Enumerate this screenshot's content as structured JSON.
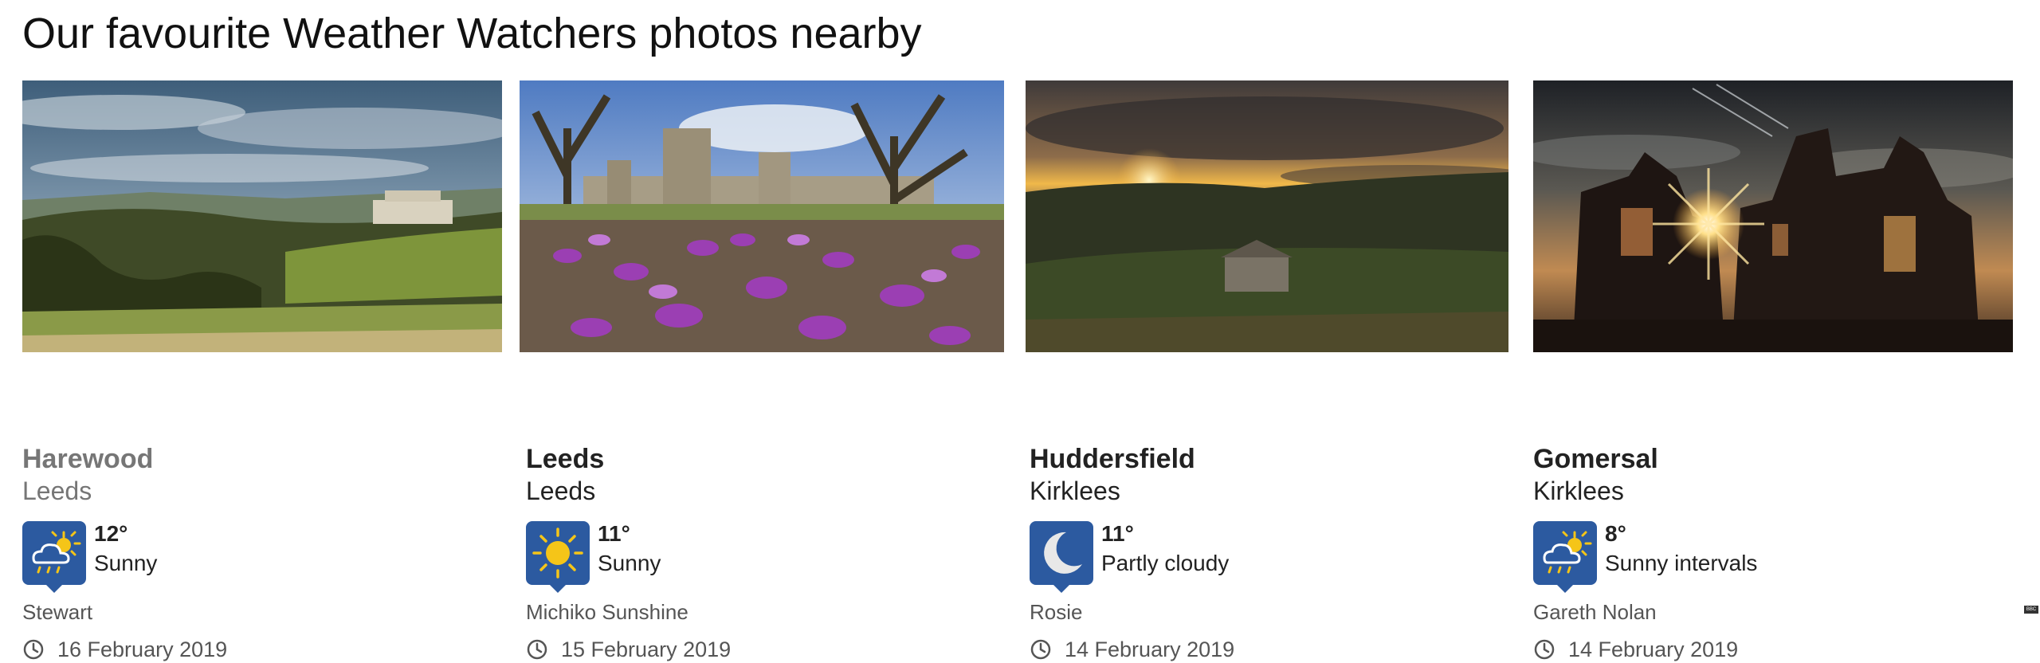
{
  "section": {
    "title": "Our favourite Weather Watchers photos nearby"
  },
  "cards": [
    {
      "place": "Harewood",
      "region": "Leeds",
      "icon": "sunny-intervals-icon",
      "temperature": "12°",
      "condition": "Sunny",
      "author": "Stewart",
      "date": "16 February 2019"
    },
    {
      "place": "Leeds",
      "region": "Leeds",
      "icon": "sun-icon",
      "temperature": "11°",
      "condition": "Sunny",
      "author": "Michiko Sunshine",
      "date": "15 February 2019"
    },
    {
      "place": "Huddersfield",
      "region": "Kirklees",
      "icon": "moon-icon",
      "temperature": "11°",
      "condition": "Partly cloudy",
      "author": "Rosie",
      "date": "14 February 2019"
    },
    {
      "place": "Gomersal",
      "region": "Kirklees",
      "icon": "sunny-intervals-icon",
      "temperature": "8°",
      "condition": "Sunny intervals",
      "author": "Gareth Nolan",
      "date": "14 February 2019"
    }
  ],
  "footer": {
    "badge": "BBC"
  },
  "colors": {
    "icon_bg": "#2c5aa0",
    "sun": "#f5c518",
    "text": "#222222",
    "muted": "#767676"
  }
}
